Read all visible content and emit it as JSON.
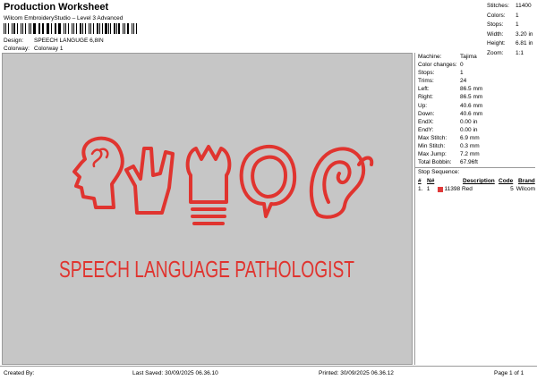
{
  "header": {
    "title": "Production Worksheet",
    "subtitle": "Wilcom EmbroideryStudio – Level 3 Advanced"
  },
  "design": {
    "label": "Design:",
    "value": "SPEECH LANGUGE 6,8IN"
  },
  "colorway": {
    "label": "Colorway:",
    "value": "Colorway 1"
  },
  "top_stats": [
    {
      "label": "Stitches:",
      "value": "11400"
    },
    {
      "label": "Colors:",
      "value": "1"
    },
    {
      "label": "Stops:",
      "value": "1"
    },
    {
      "label": "Width:",
      "value": "3.20 in"
    },
    {
      "label": "Height:",
      "value": "6.81 in"
    },
    {
      "label": "Zoom:",
      "value": "1:1"
    }
  ],
  "details": [
    {
      "label": "Machine:",
      "value": "Tajima"
    },
    {
      "label": "Color changes:",
      "value": "0"
    },
    {
      "label": "Stops:",
      "value": "1"
    },
    {
      "label": "Trims:",
      "value": "24"
    },
    {
      "label": "Left:",
      "value": "86.5 mm"
    },
    {
      "label": "Right:",
      "value": "86.5 mm"
    },
    {
      "label": "Up:",
      "value": "40.6 mm"
    },
    {
      "label": "Down:",
      "value": "40.6 mm"
    },
    {
      "label": "EndX:",
      "value": "0.00 in"
    },
    {
      "label": "EndY:",
      "value": "0.00 in"
    },
    {
      "label": "Max Stitch:",
      "value": "6.9 mm"
    },
    {
      "label": "Min Stitch:",
      "value": "0.3 mm"
    },
    {
      "label": "Max Jump:",
      "value": "7.2 mm"
    },
    {
      "label": "Total Bobbin:",
      "value": "67.96ft"
    }
  ],
  "stop_sequence": {
    "title": "Stop Sequence:",
    "headers": [
      "#",
      "N#",
      "",
      "Description",
      "Code",
      "Brand"
    ],
    "rows": [
      {
        "num": "1.",
        "n": "1",
        "code_num": "11398",
        "description": "Red",
        "code": "5",
        "brand": "Wilcom"
      }
    ]
  },
  "artwork": {
    "text": "SPEECH LANGUAGE PATHOLOGIST",
    "thread_color": "#e0342f"
  },
  "colors": {
    "canvas_bg": "#c6c6c6",
    "swatch": "#e03a3a"
  },
  "footer": {
    "created_by": "Created By:",
    "last_saved": "Last Saved: 30/09/2025 06.36.10",
    "printed": "Printed: 30/09/2025 06.36.12",
    "page": "Page 1 of 1"
  }
}
